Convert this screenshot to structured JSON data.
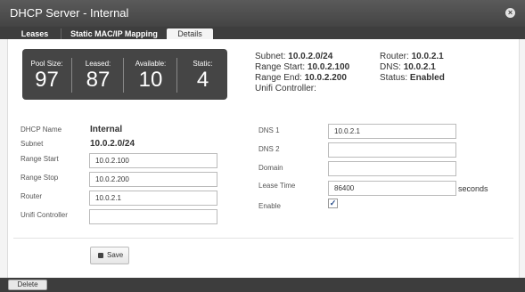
{
  "window": {
    "title": "DHCP Server - Internal"
  },
  "tabs": [
    {
      "label": "Leases"
    },
    {
      "label": "Static MAC/IP Mapping"
    },
    {
      "label": "Details"
    }
  ],
  "stats": {
    "pool_size": {
      "label": "Pool Size:",
      "value": "97"
    },
    "leased": {
      "label": "Leased:",
      "value": "87"
    },
    "available": {
      "label": "Available:",
      "value": "10"
    },
    "static": {
      "label": "Static:",
      "value": "4"
    }
  },
  "summary": {
    "subnet": {
      "label": "Subnet:",
      "value": "10.0.2.0/24"
    },
    "range_start": {
      "label": "Range Start:",
      "value": "10.0.2.100"
    },
    "range_end": {
      "label": "Range End:",
      "value": "10.0.2.200"
    },
    "unifi": {
      "label": "Unifi Controller:",
      "value": ""
    },
    "router": {
      "label": "Router:",
      "value": "10.0.2.1"
    },
    "dns": {
      "label": "DNS:",
      "value": "10.0.2.1"
    },
    "status": {
      "label": "Status:",
      "value": "Enabled"
    }
  },
  "form": {
    "dhcp_name": {
      "label": "DHCP Name",
      "value": "Internal"
    },
    "subnet": {
      "label": "Subnet",
      "value": "10.0.2.0/24"
    },
    "range_start": {
      "label": "Range Start",
      "value": "10.0.2.100"
    },
    "range_stop": {
      "label": "Range Stop",
      "value": "10.0.2.200"
    },
    "router": {
      "label": "Router",
      "value": "10.0.2.1"
    },
    "unifi_controller": {
      "label": "Unifi Controller",
      "value": ""
    },
    "dns1": {
      "label": "DNS 1",
      "value": "10.0.2.1"
    },
    "dns2": {
      "label": "DNS 2",
      "value": ""
    },
    "domain": {
      "label": "Domain",
      "value": ""
    },
    "lease_time": {
      "label": "Lease Time",
      "value": "86400",
      "unit": "seconds"
    },
    "enable": {
      "label": "Enable",
      "checked": true
    }
  },
  "buttons": {
    "save": "Save",
    "delete": "Delete"
  },
  "icons": {
    "close": "close-icon",
    "save": "save-icon",
    "check": "check-icon"
  },
  "colors": {
    "titlebar": "#4e4e4e",
    "panel": "#454545",
    "check": "#2a4e8a"
  }
}
